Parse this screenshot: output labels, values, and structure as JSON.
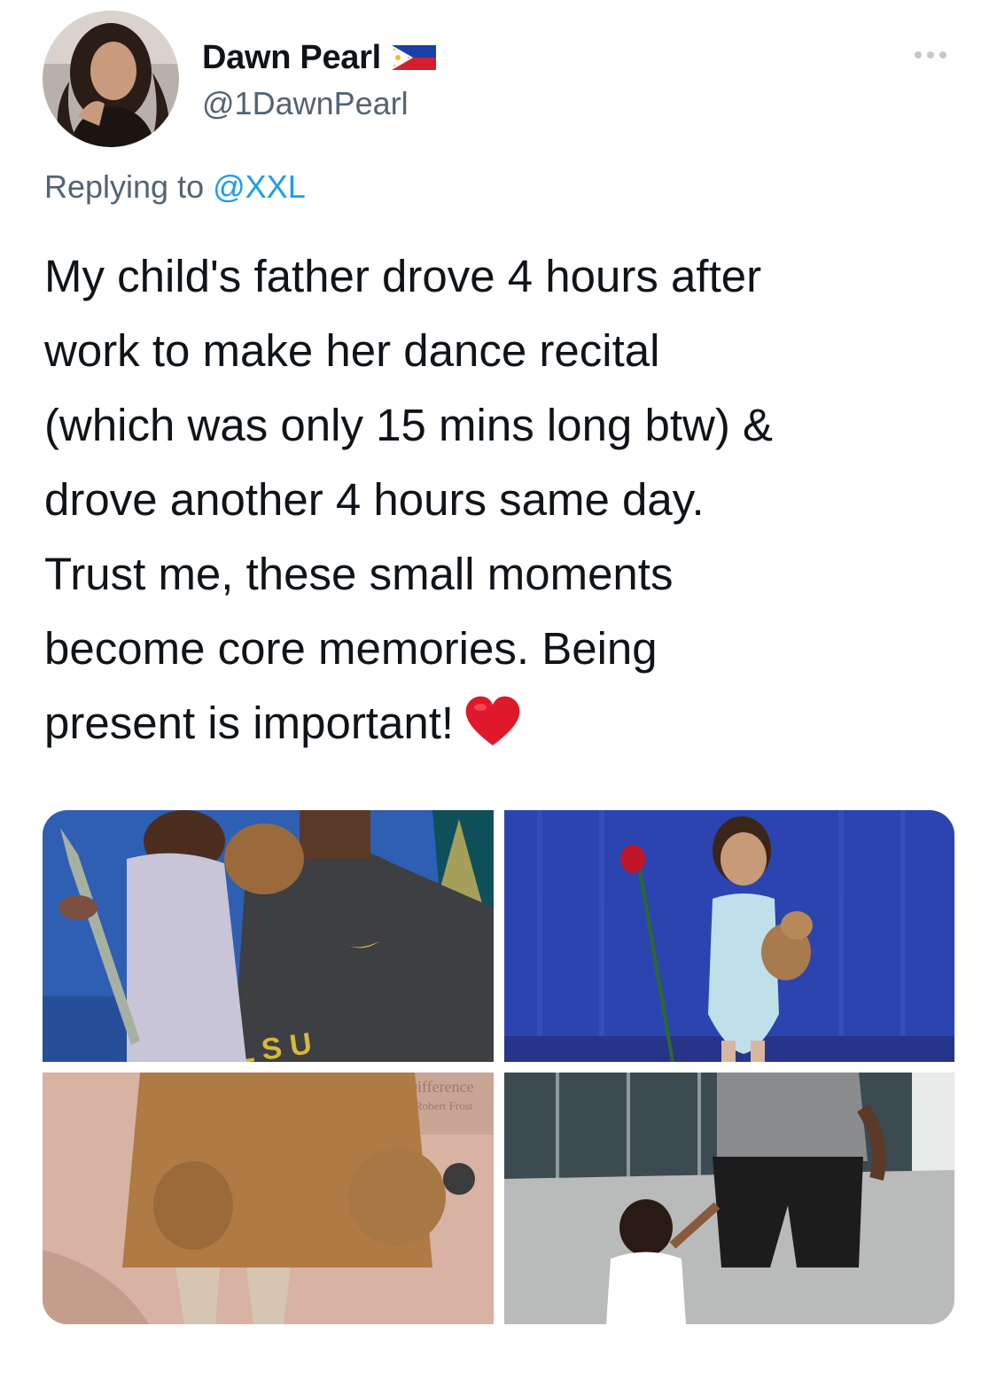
{
  "author": {
    "display_name": "Dawn Pearl",
    "handle": "@1DawnPearl",
    "flag_icon": "philippines-flag-icon"
  },
  "reply": {
    "prefix": "Replying to",
    "mention": "@XXL"
  },
  "tweet": {
    "text": "My child's father drove 4 hours after\nwork to make her dance recital\n(which was only 15 mins long btw) &\ndrove another 4 hours same day.\nTrust me, these small moments\nbecome core memories. Being\npresent is important!",
    "emoji": "red-heart-icon"
  },
  "media": {
    "photo_1_caption": "L S U\nTIGERS",
    "photo_3_caption": "Difference\nRobert Frost"
  },
  "colors": {
    "text": "#0f1419",
    "secondary": "#536471",
    "link": "#1d9bf0"
  }
}
